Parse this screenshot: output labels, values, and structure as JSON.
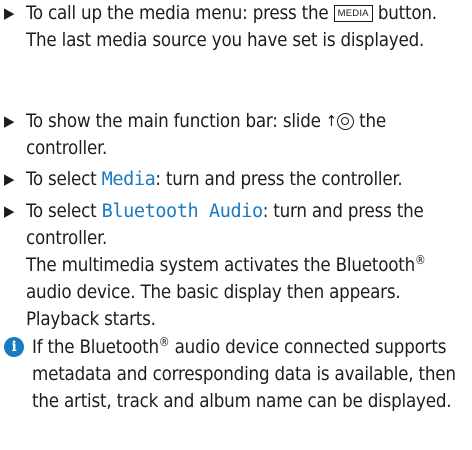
{
  "steps": [
    {
      "pre": "To call up the media menu: press the ",
      "key": "MEDIA",
      "post": " button.",
      "result": "The last media source you have set is displayed."
    },
    {
      "pre": "To show the main function bar: slide ",
      "post": " the controller."
    },
    {
      "pre": "To select ",
      "highlight": "Media",
      "post": ": turn and press the controller."
    },
    {
      "pre": "To select ",
      "highlight": "Bluetooth Audio",
      "post": ": turn and press the controller.",
      "result_pre": "The multimedia system activates the Bluetooth",
      "result_sup": "®",
      "result_post": " audio device. The basic display then appears. Playback starts."
    }
  ],
  "note": {
    "pre": "If the Bluetooth",
    "sup": "®",
    "post": " audio device connected supports metadata and corresponding data is available, then the artist, track and album name can be displayed."
  },
  "icons": {
    "bullet": "right-triangle-bullet",
    "controller": "controller-slide-up-icon",
    "info": "info-icon"
  },
  "colors": {
    "highlight": "#1a7ac2",
    "info_icon": "#1a7ac2"
  }
}
